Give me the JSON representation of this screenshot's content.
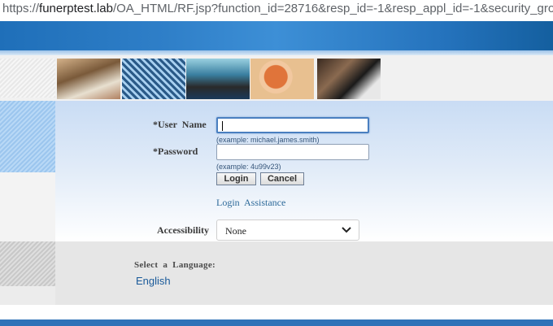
{
  "browser": {
    "url_host": "funerptest.lab",
    "url_prefix": "https://",
    "url_path": "/OA_HTML/RF.jsp?function_id=28716&resp_id=-1&resp_appl_id=-1&security_grou"
  },
  "login": {
    "username_label": "*User  Name",
    "username_value": "",
    "username_hint": "(example: michael.james.smith)",
    "password_label": "*Password",
    "password_value": "",
    "password_hint": "(example: 4u99v23)",
    "login_button": "Login",
    "cancel_button": "Cancel",
    "assistance_link": "Login  Assistance"
  },
  "accessibility": {
    "label": "Accessibility",
    "selected": "None"
  },
  "language": {
    "title": "Select  a  Language:",
    "option": "English"
  },
  "colors": {
    "banner": "#2f7fc8",
    "link": "#1a5a9a",
    "footer": "#2f72b8"
  }
}
